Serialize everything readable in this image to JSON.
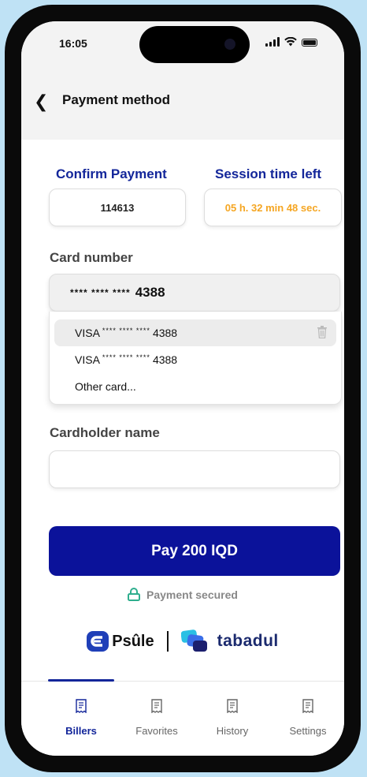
{
  "status": {
    "time": "16:05"
  },
  "header": {
    "title": "Payment method"
  },
  "confirm": {
    "label": "Confirm Payment",
    "code": "114613"
  },
  "session": {
    "label": "Session time left",
    "value": "05 h. 32 min 48 sec."
  },
  "card": {
    "label": "Card number",
    "selected_mask": "**** **** ****",
    "selected_last": "4388",
    "options": [
      {
        "brand": "VISA",
        "mask": "**** **** ****",
        "last": "4388"
      },
      {
        "brand": "VISA",
        "mask": "**** **** ****",
        "last": "4388"
      }
    ],
    "other": "Other card..."
  },
  "cardholder": {
    "label": "Cardholder name",
    "value": "",
    "placeholder": ""
  },
  "pay": {
    "label": "Pay 200 IQD"
  },
  "secured": {
    "label": "Payment secured"
  },
  "brands": {
    "psule": "Psûle",
    "tabadul": "tabadul"
  },
  "nav": {
    "items": [
      {
        "label": "Billers",
        "icon": "receipt-icon"
      },
      {
        "label": "Favorites",
        "icon": "receipt-icon"
      },
      {
        "label": "History",
        "icon": "receipt-icon"
      },
      {
        "label": "Settings",
        "icon": "receipt-icon"
      }
    ],
    "active": 0
  },
  "colors": {
    "primary": "#0b129a",
    "accent_orange": "#f5a623",
    "secure_green": "#2fae8e",
    "text_dark": "#111111"
  }
}
